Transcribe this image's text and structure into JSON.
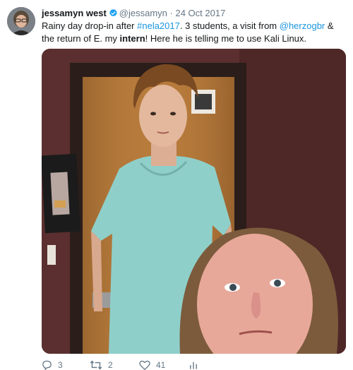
{
  "tweet": {
    "author_name": "jessamyn west",
    "handle": "@jessamyn",
    "separator": "·",
    "date": "24 Oct 2017",
    "text_parts": {
      "p1": "Rainy day drop-in after ",
      "hashtag": "#nela2017",
      "p2": ". 3 students, a visit from ",
      "mention": "@herzogbr",
      "p3": " & the return of E. my ",
      "bold": "intern",
      "p4": "! Here he is telling me to use Kali Linux."
    },
    "actions": {
      "reply_count": "3",
      "retweet_count": "2",
      "like_count": "41"
    },
    "icons": {
      "verified": "verified-badge-icon",
      "reply": "reply-icon",
      "retweet": "retweet-icon",
      "like": "heart-icon",
      "analytics": "analytics-icon"
    },
    "colors": {
      "link": "#1b95e0",
      "verified": "#1da1f2",
      "secondary_text": "#657786"
    }
  }
}
